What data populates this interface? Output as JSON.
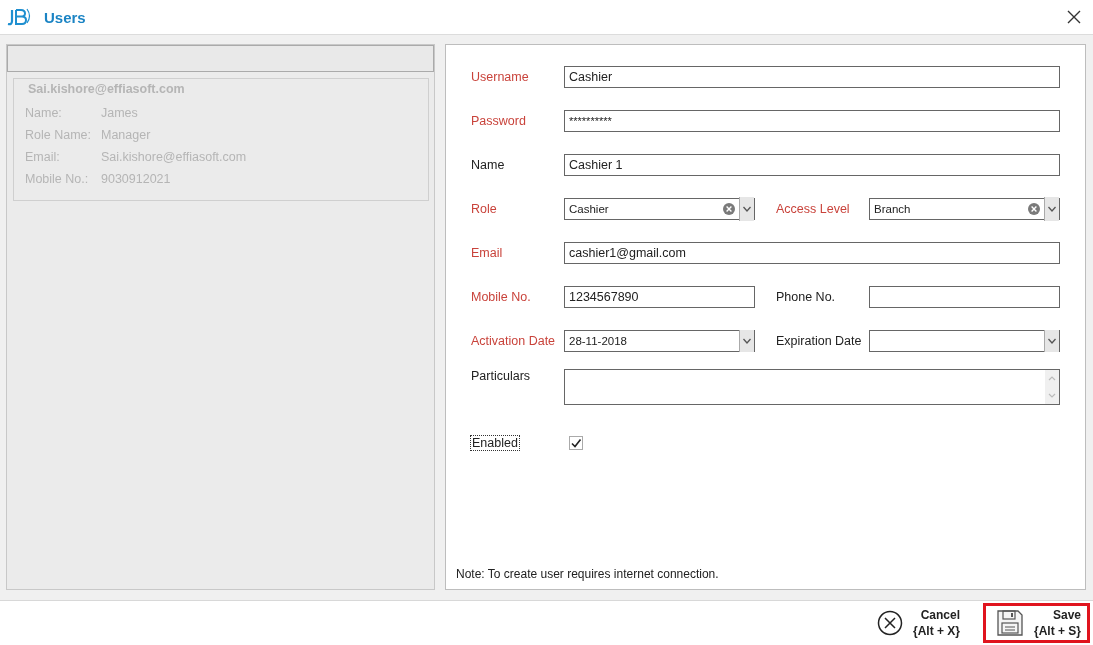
{
  "window": {
    "title": "Users"
  },
  "user_card": {
    "header": "Sai.kishore@effiasoft.com",
    "details": [
      {
        "label": "Name:",
        "value": "James"
      },
      {
        "label": "Role Name:",
        "value": "Manager"
      },
      {
        "label": "Email:",
        "value": "Sai.kishore@effiasoft.com"
      },
      {
        "label": "Mobile No.:",
        "value": "9030912021"
      }
    ]
  },
  "form": {
    "rows": [
      {
        "fields": [
          {
            "label": "Username",
            "required": true,
            "kind": "text",
            "value": "Cashier"
          }
        ]
      },
      {
        "fields": [
          {
            "label": "Password",
            "required": true,
            "kind": "password",
            "value": "**********"
          }
        ]
      },
      {
        "fields": [
          {
            "label": "Name",
            "required": false,
            "kind": "text",
            "value": "Cashier 1"
          }
        ]
      },
      {
        "fields": [
          {
            "label": "Role",
            "required": true,
            "kind": "combo",
            "value": "Cashier"
          },
          {
            "label": "Access Level",
            "required": true,
            "kind": "combo",
            "value": "Branch"
          }
        ]
      },
      {
        "fields": [
          {
            "label": "Email",
            "required": true,
            "kind": "text",
            "value": "cashier1@gmail.com"
          }
        ]
      },
      {
        "fields": [
          {
            "label": "Mobile No.",
            "required": true,
            "kind": "text",
            "value": "1234567890"
          },
          {
            "label": "Phone No.",
            "required": false,
            "kind": "text"
          }
        ]
      },
      {
        "fields": [
          {
            "label": "Activation Date",
            "required": true,
            "kind": "date",
            "value": "28-11-2018"
          },
          {
            "label": "Expiration Date",
            "required": false,
            "kind": "date"
          }
        ]
      },
      {
        "fields": [
          {
            "label": "Particulars",
            "required": false,
            "kind": "memo"
          }
        ]
      }
    ],
    "enabled": {
      "label": "Enabled",
      "checked": true
    },
    "note": "Note: To create user requires internet connection."
  },
  "buttons": [
    {
      "kind": "cancel",
      "label": "Cancel",
      "shortcut": "{Alt + X}",
      "selected": false
    },
    {
      "kind": "save",
      "label": "Save",
      "shortcut": "{Alt + S}",
      "selected": true
    }
  ]
}
